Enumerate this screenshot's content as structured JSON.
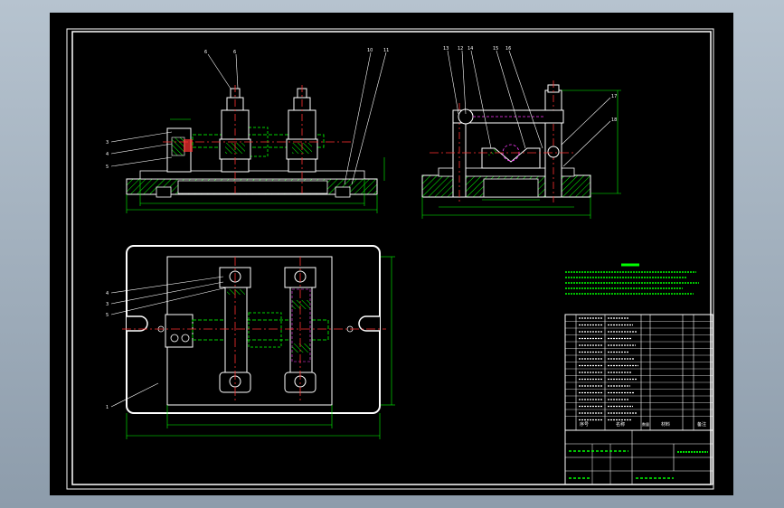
{
  "colors": {
    "background": "#000000",
    "frame": "#ffffff",
    "outline": "#ffffff",
    "hatch": "#00ff00",
    "centerline": "#ff3030",
    "hidden": "#ff3cff",
    "dimension": "#00ff00",
    "notes": "#00ff00",
    "shaft": "#00d000"
  },
  "front_view": {
    "balloons": [
      "6",
      "6",
      "10",
      "11",
      "3",
      "4",
      "5"
    ]
  },
  "side_view": {
    "balloons": [
      "13",
      "12",
      "14",
      "15",
      "16",
      "17",
      "18"
    ]
  },
  "plan_view": {
    "balloons": [
      "4",
      "3",
      "5",
      "1"
    ]
  },
  "parts_list": {
    "header": [
      "序号",
      "名称",
      "数量",
      "材料",
      "备注"
    ]
  }
}
